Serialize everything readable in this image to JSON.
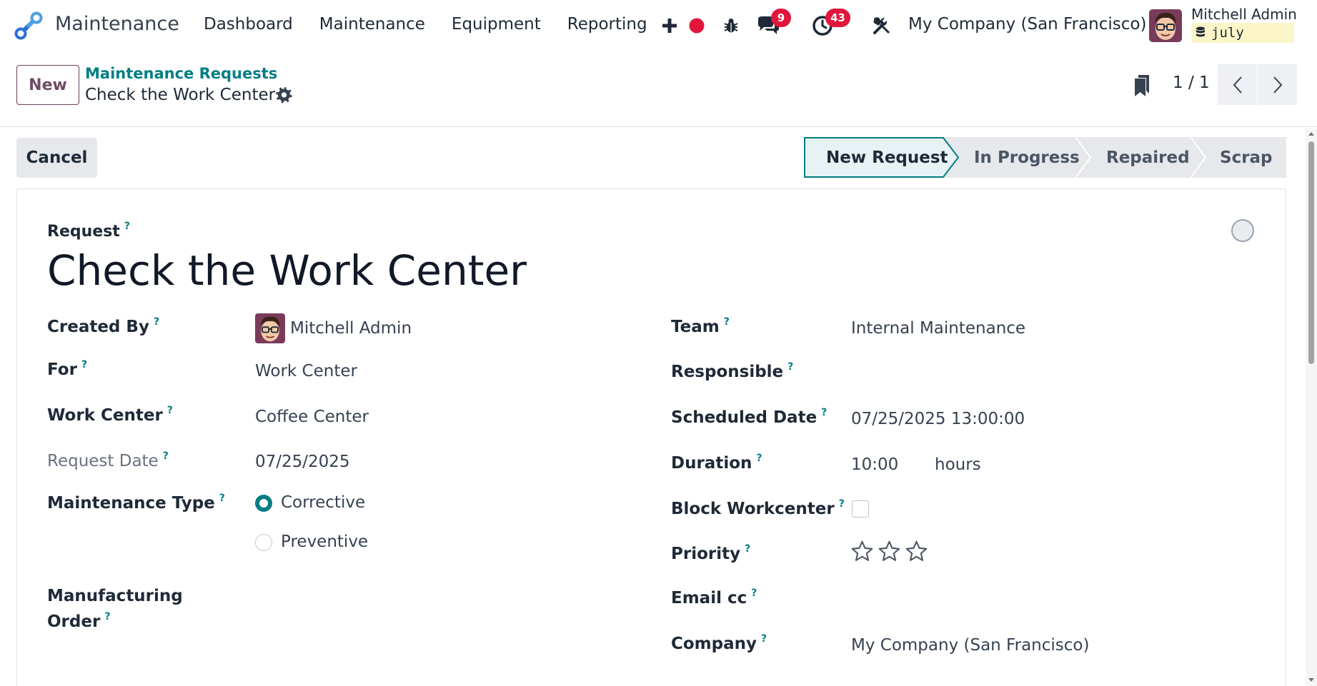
{
  "navbar": {
    "app_name": "Maintenance",
    "menu": [
      "Dashboard",
      "Maintenance",
      "Equipment",
      "Reporting"
    ],
    "messages_count": "9",
    "activities_count": "43",
    "company": "My Company (San Francisco)",
    "user_name": "Mitchell Admin",
    "database": "july",
    "badge_color": "#e1163c"
  },
  "control_panel": {
    "new_label": "New",
    "breadcrumb_parent": "Maintenance Requests",
    "breadcrumb_current": "Check the Work Center",
    "pager": "1 / 1"
  },
  "statusbar": {
    "cancel_label": "Cancel",
    "stages": [
      "New Request",
      "In Progress",
      "Repaired",
      "Scrap"
    ],
    "active_stage": "New Request",
    "accent_color": "#017e84"
  },
  "form": {
    "request_label": "Request",
    "title": "Check the Work Center",
    "help_mark": "?",
    "left": {
      "created_by": {
        "label": "Created By",
        "value": "Mitchell Admin"
      },
      "for": {
        "label": "For",
        "value": "Work Center"
      },
      "work_center": {
        "label": "Work Center",
        "value": "Coffee Center"
      },
      "request_date": {
        "label": "Request Date",
        "value": "07/25/2025"
      },
      "maintenance_type": {
        "label": "Maintenance Type",
        "options": [
          "Corrective",
          "Preventive"
        ],
        "selected": "Corrective"
      },
      "manufacturing_order": {
        "label_line1": "Manufacturing",
        "label_line2": "Order",
        "value": ""
      }
    },
    "right": {
      "team": {
        "label": "Team",
        "value": "Internal Maintenance"
      },
      "responsible": {
        "label": "Responsible",
        "value": ""
      },
      "scheduled_date": {
        "label": "Scheduled Date",
        "value": "07/25/2025 13:00:00"
      },
      "duration": {
        "label": "Duration",
        "value": "10:00",
        "unit": "hours"
      },
      "block_workcenter": {
        "label": "Block Workcenter",
        "checked": false
      },
      "priority": {
        "label": "Priority",
        "stars_filled": 0,
        "stars_total": 3
      },
      "email_cc": {
        "label": "Email cc",
        "value": ""
      },
      "company": {
        "label": "Company",
        "value": "My Company (San Francisco)"
      }
    }
  }
}
